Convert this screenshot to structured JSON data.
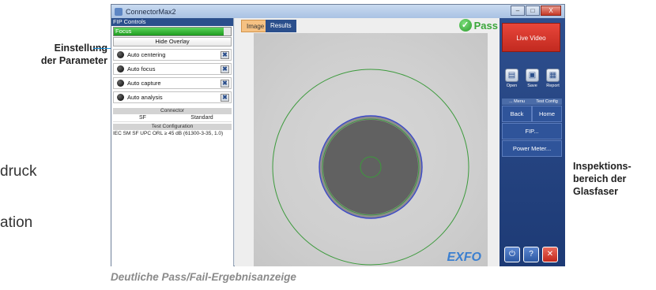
{
  "background": {
    "text_lines": [
      "druck",
      "ation"
    ]
  },
  "callouts": {
    "left": [
      "Einstellung",
      "der Parameter"
    ],
    "right": [
      "Inspektions-",
      "bereich der",
      "Glasfaser"
    ]
  },
  "caption": "Deutliche Pass/Fail-Ergebnisanzeige",
  "window": {
    "title": "ConnectorMax2",
    "controls": {
      "minimize": "–",
      "maximize": "□",
      "close": "X"
    }
  },
  "left_panel": {
    "header": "FIP Controls",
    "focus_label": "Focus",
    "focus_level": 0.94,
    "hide_overlay": "Hide Overlay",
    "options": [
      {
        "label": "Auto centering"
      },
      {
        "label": "Auto focus"
      },
      {
        "label": "Auto capture"
      },
      {
        "label": "Auto analysis"
      }
    ],
    "connector_header": "Connector",
    "connector_values": [
      "SF",
      "Standard"
    ],
    "test_config_header": "Test Configuration",
    "test_config_value": "IEC SM SF UPC ORL ≥ 45 dB (61300-3-35, 1.0)"
  },
  "center": {
    "tabs": [
      "Image",
      "Results"
    ],
    "result": "Pass",
    "brand": "EXFO",
    "colors": {
      "zone_circles": "#3c9a3c",
      "cladding_edge": "#3c49c8",
      "core": "#616161"
    }
  },
  "right_panel": {
    "live_video": "Live Video",
    "file_buttons": [
      {
        "label": "Open",
        "icon": "folder-icon"
      },
      {
        "label": "Save",
        "icon": "save-icon"
      },
      {
        "label": "Report",
        "icon": "report-icon"
      }
    ],
    "menu_tabs": [
      "... Menu",
      "Test Config"
    ],
    "nav": {
      "back": "Back",
      "home": "Home",
      "fip": "FIP...",
      "power_meter": "Power Meter..."
    },
    "bottom_icons": [
      "power-icon",
      "help-icon",
      "exit-icon"
    ]
  }
}
